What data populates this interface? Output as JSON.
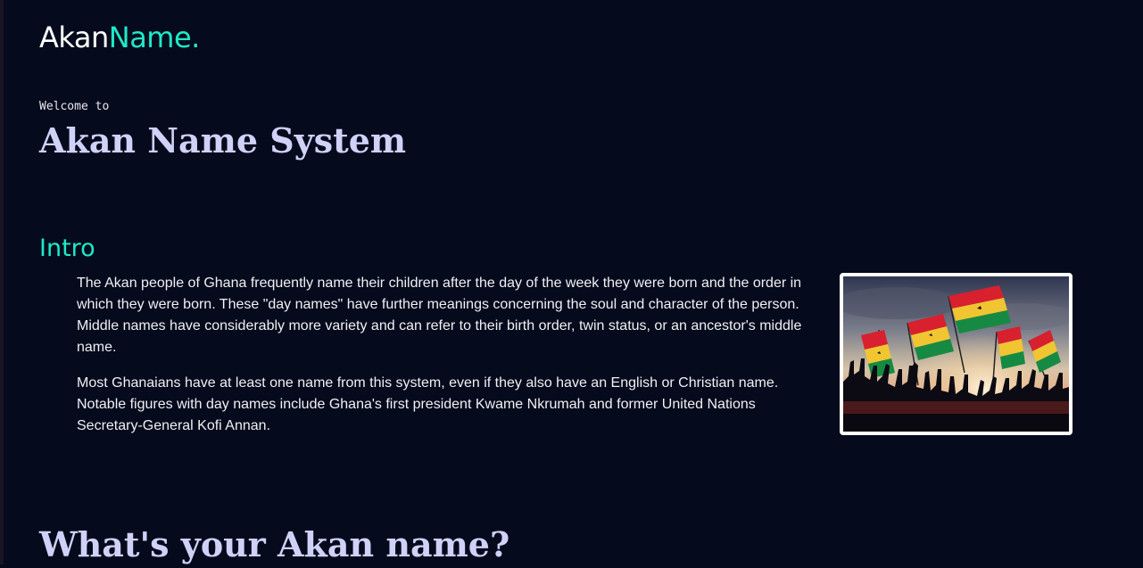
{
  "header": {
    "logo_part1": "Akan",
    "logo_part2": "Name."
  },
  "hero": {
    "welcome": "Welcome to",
    "title": "Akan Name System"
  },
  "intro": {
    "title": "Intro",
    "paragraphs": [
      "The Akan people of Ghana frequently name their children after the day of the week they were born and the order in which they were born. These \"day names\" have further meanings concerning the soul and character of the person. Middle names have considerably more variety and can refer to their birth order, twin status, or an ancestor's middle name.",
      "Most Ghanaians have at least one name from this system, even if they also have an English or Christian name. Notable figures with day names include Ghana's first president Kwame Nkrumah and former United Nations Secretary-General Kofi Annan."
    ]
  },
  "question_section": {
    "title": "What's your Akan name?"
  },
  "colors": {
    "background": "#050a1c",
    "accent": "#1de9c8",
    "heading": "#cfd1f7"
  }
}
